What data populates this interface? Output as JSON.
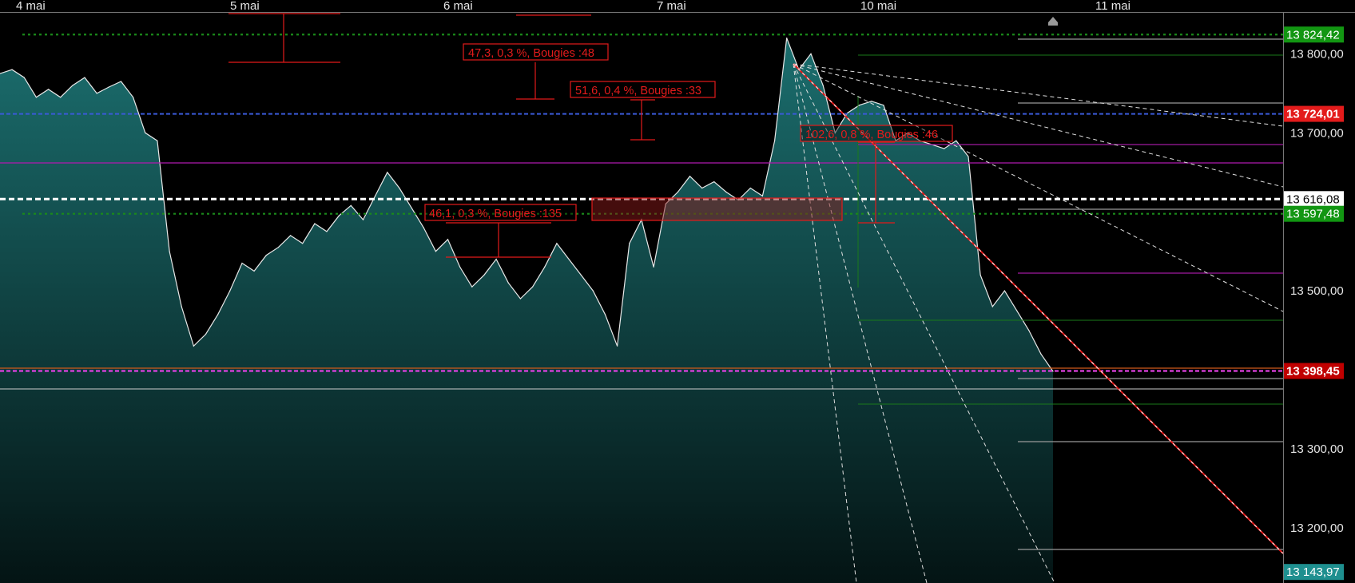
{
  "chart_data": {
    "type": "area",
    "title": "",
    "xlabel": "",
    "ylabel": "",
    "x_tick_labels": [
      "4 mai",
      "5 mai",
      "6 mai",
      "7 mai",
      "10 mai",
      "11 mai"
    ],
    "y_tick_labels": [
      "13 800,00",
      "13 700,00",
      "13 500,00",
      "13 300,00",
      "13 200,00"
    ],
    "y_ticks": [
      13800,
      13700,
      13500,
      13300,
      13200
    ],
    "ylim": [
      13130,
      13852
    ],
    "grid": false,
    "series": [
      {
        "values": [
          13775,
          13780,
          13770,
          13745,
          13755,
          13745,
          13760,
          13770,
          13750,
          13758,
          13765,
          13745,
          13700,
          13690,
          13550,
          13480,
          13430,
          13445,
          13470,
          13500,
          13535,
          13525,
          13545,
          13555,
          13570,
          13560,
          13585,
          13575,
          13595,
          13608,
          13590,
          13620,
          13650,
          13630,
          13605,
          13580,
          13550,
          13565,
          13530,
          13505,
          13520,
          13540,
          13510,
          13490,
          13505,
          13530,
          13560,
          13540,
          13520,
          13500,
          13470,
          13430,
          13560,
          13590,
          13530,
          13610,
          13625,
          13645,
          13630,
          13638,
          13625,
          13615,
          13630,
          13620,
          13690,
          13820,
          13780,
          13800,
          13760,
          13700,
          13725,
          13735,
          13740,
          13735,
          13690,
          13700,
          13690,
          13685,
          13680,
          13690,
          13670,
          13520,
          13480,
          13500,
          13475,
          13450,
          13420,
          13398
        ]
      }
    ],
    "reference_levels": [
      {
        "value": 13824.42,
        "label": "13 824,42",
        "color": "#1a8a1a",
        "style": "dotted"
      },
      {
        "value": 13724.01,
        "label": "13 724,01",
        "color": "#e00000",
        "style": "dashed-blue"
      },
      {
        "value": 13616.08,
        "label": "13 616,08",
        "color": "#ffffff",
        "style": "dashed"
      },
      {
        "value": 13597.48,
        "label": "13 597,48",
        "color": "#1a8a1a",
        "style": "dotted"
      },
      {
        "value": 13398.45,
        "label": "13 398,45",
        "color": "#c00000",
        "style": "dashed-magenta"
      },
      {
        "value": 13143.97,
        "label": "13 143,97",
        "color": "#1e8f8f",
        "style": "none"
      }
    ],
    "annotations": [
      "47,3, 0,3 %, Bougies :48",
      "51,6, 0,4 %, Bougies :33",
      "102,6, 0,8 %, Bougies :46",
      "46,1, 0,3 %, Bougies :135"
    ],
    "colors": {
      "background": "#000000",
      "area_top": "#1b6e6e",
      "area_bottom": "#051515",
      "price_line": "#e8e8e8",
      "annotation": "#e31b1b",
      "trendline": "#e31b1b"
    }
  }
}
